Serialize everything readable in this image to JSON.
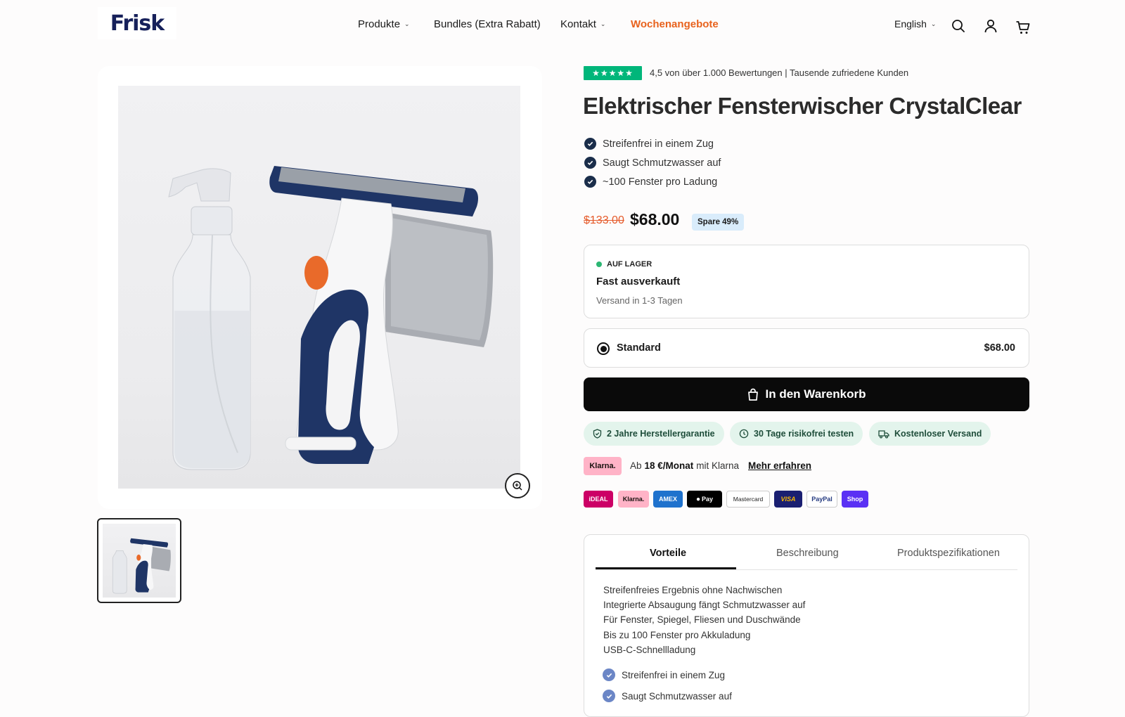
{
  "header": {
    "logo": "Frisk",
    "nav": [
      "Produkte",
      "Bundles (Extra Rabatt)",
      "Kontakt",
      "Wochenangebote"
    ],
    "language": "English"
  },
  "product": {
    "rating_stars": "★★★★★",
    "rating_text": "4,5 von über 1.000 Bewertungen | Tausende zufriedene Kunden",
    "title": "Elektrischer Fensterwischer CrystalClear",
    "features": [
      "Streifenfrei in einem Zug",
      "Saugt Schmutzwasser auf",
      "~100 Fenster pro Ladung"
    ],
    "price_old": "$133.00",
    "price_new": "$68.00",
    "save_badge": "Spare 49%"
  },
  "stock": {
    "status": "AUF LAGER",
    "headline": "Fast ausverkauft",
    "shipping": "Versand in 1-3 Tagen"
  },
  "variant": {
    "label": "Standard",
    "price": "$68.00"
  },
  "cart_button": "In den Warenkorb",
  "badges": [
    "2 Jahre Herstellergarantie",
    "30 Tage risikofrei testen",
    "Kostenloser Versand"
  ],
  "klarna": {
    "logo": "Klarna.",
    "prefix": "Ab",
    "amount": "18 €/Monat",
    "suffix": "mit Klarna",
    "link": "Mehr erfahren"
  },
  "payment_methods": [
    "iDEAL",
    "Klarna.",
    "AMEX",
    "Pay",
    "Mastercard",
    "VISA",
    "PayPal",
    "Shop"
  ],
  "tabs": {
    "items": [
      "Vorteile",
      "Beschreibung",
      "Produktspezifikationen"
    ],
    "active": "Vorteile",
    "benefits_text": [
      "Streifenfreies Ergebnis ohne Nachwischen",
      "Integrierte Absaugung fängt Schmutzwasser auf",
      "Für Fenster, Spiegel, Fliesen und Duschwände",
      "Bis zu 100 Fenster pro Akkuladung",
      "USB-C-Schnellladung"
    ],
    "benefits_checked": [
      "Streifenfrei in einem Zug",
      "Saugt Schmutzwasser auf"
    ]
  },
  "colors": {
    "accent_orange": "#e8621d",
    "navy": "#16205a",
    "trustpilot": "#00b67a",
    "stock_dot": "#2bb673"
  }
}
